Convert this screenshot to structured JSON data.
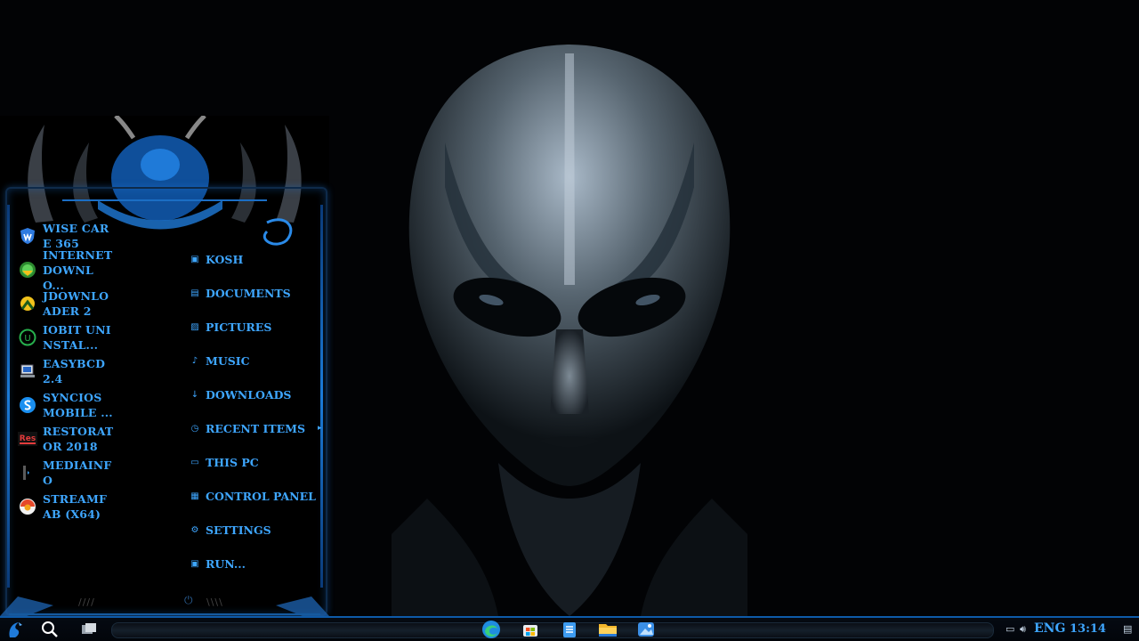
{
  "start_menu": {
    "apps": [
      {
        "label": "WISE CARE 365",
        "icon": "wise-care-icon"
      },
      {
        "label": "INTERNET DOWNLO...",
        "icon": "internet-download-manager-icon"
      },
      {
        "label": "JDOWNLOADER 2",
        "icon": "jdownloader-icon"
      },
      {
        "label": "IOBIT UNINSTAL...",
        "icon": "iobit-uninstaller-icon"
      },
      {
        "label": "EASYBCD 2.4",
        "icon": "easybcd-icon"
      },
      {
        "label": "SYNCIOS MOBILE ...",
        "icon": "syncios-icon"
      },
      {
        "label": "RESTORATOR 2018",
        "icon": "restorator-icon"
      },
      {
        "label": "MEDIAINFO",
        "icon": "mediainfo-icon"
      },
      {
        "label": "STREAMFAB (X64)",
        "icon": "streamfab-icon"
      }
    ],
    "places": [
      {
        "label": "KOSH",
        "icon": "user-folder-icon"
      },
      {
        "label": "DOCUMENTS",
        "icon": "document-icon"
      },
      {
        "label": "PICTURES",
        "icon": "picture-icon"
      },
      {
        "label": "MUSIC",
        "icon": "music-note-icon"
      },
      {
        "label": "DOWNLOADS",
        "icon": "download-arrow-icon"
      },
      {
        "label": "RECENT ITEMS",
        "icon": "clock-icon",
        "submenu": true
      },
      {
        "label": "THIS PC",
        "icon": "computer-icon"
      },
      {
        "label": "CONTROL PANEL",
        "icon": "control-panel-icon"
      },
      {
        "label": "SETTINGS",
        "icon": "gear-icon"
      },
      {
        "label": "RUN...",
        "icon": "run-icon"
      }
    ],
    "accent": "#3ea6ff"
  },
  "taskbar": {
    "pinned": [
      "start-dragon-icon",
      "search-icon",
      "task-view-icon",
      "edge-icon",
      "store-icon",
      "notepad-icon",
      "file-explorer-icon",
      "photos-icon"
    ],
    "tray": {
      "language": "ENG",
      "clock": "13:14"
    }
  }
}
